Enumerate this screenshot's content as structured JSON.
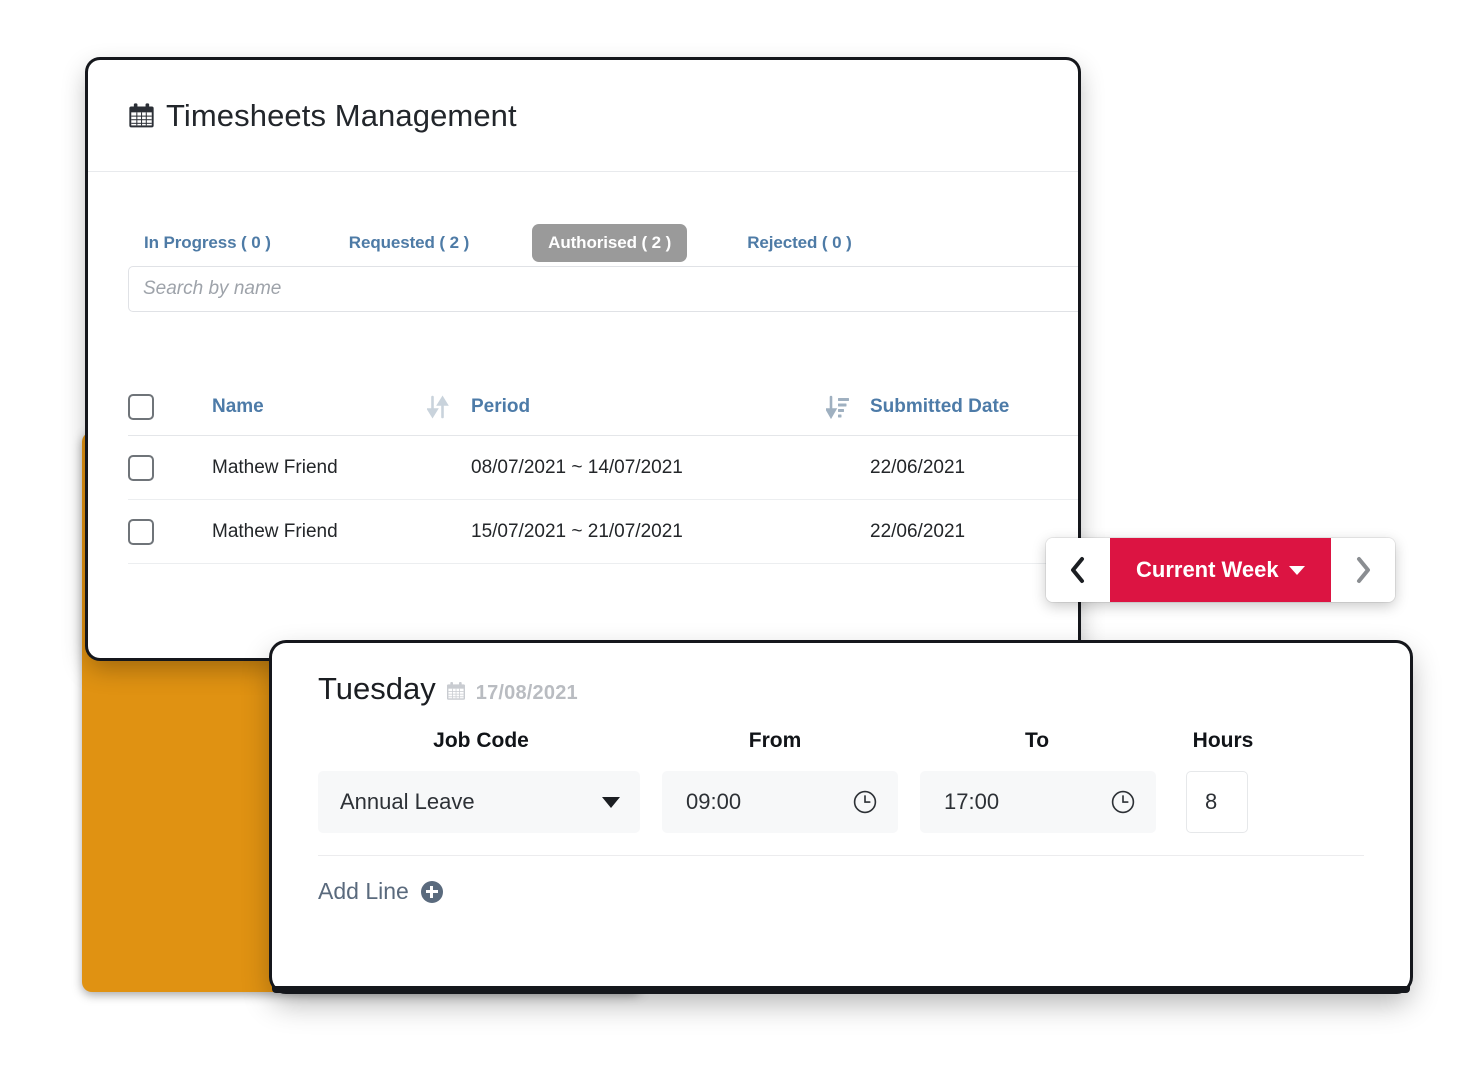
{
  "main_card": {
    "title": "Timesheets Management",
    "title_icon": "calendar-icon",
    "tabs": [
      {
        "label": "In Progress ( 0 )",
        "active": false
      },
      {
        "label": "Requested ( 2 )",
        "active": false
      },
      {
        "label": "Authorised ( 2 )",
        "active": true
      },
      {
        "label": "Rejected ( 0 )",
        "active": false
      }
    ],
    "search": {
      "placeholder": "Search by name",
      "value": "",
      "icon": "search-input"
    },
    "table": {
      "columns": [
        {
          "label": "Name",
          "sort_icon": "sort-updown-icon"
        },
        {
          "label": "Period",
          "sort_icon": "sort-amount-down-icon"
        },
        {
          "label": "Submitted Date",
          "sort_icon": "sort-updown-icon"
        }
      ],
      "rows": [
        {
          "selected": false,
          "name": "Mathew Friend",
          "period": "08/07/2021 ~ 14/07/2021",
          "submitted_date": "22/06/2021"
        },
        {
          "selected": false,
          "name": "Mathew Friend",
          "period": "15/07/2021 ~ 21/07/2021",
          "submitted_date": "22/06/2021"
        }
      ]
    }
  },
  "week_nav": {
    "prev_icon": "chevron-left-icon",
    "next_icon": "chevron-right-icon",
    "label": "Current Week",
    "caret_icon": "caret-down-icon",
    "accent_color": "#dc1442"
  },
  "day_card": {
    "day_name": "Tuesday",
    "date_icon": "calendar-icon",
    "date": "17/08/2021",
    "columns": [
      "Job Code",
      "From",
      "To",
      "Hours"
    ],
    "lines": [
      {
        "job_code": "Annual Leave",
        "from": "09:00",
        "to": "17:00",
        "hours": "8",
        "from_icon": "clock-icon",
        "to_icon": "clock-icon",
        "dropdown_icon": "caret-down-icon"
      }
    ],
    "add_line": {
      "label": "Add Line",
      "icon": "plus-circle-icon"
    }
  },
  "theme": {
    "orange_card": "#e09212",
    "accent_red": "#dc1442",
    "tab_link": "#4e7ba6",
    "tab_active_bg": "#9a9a9a",
    "header_link": "#4d7ba8"
  }
}
